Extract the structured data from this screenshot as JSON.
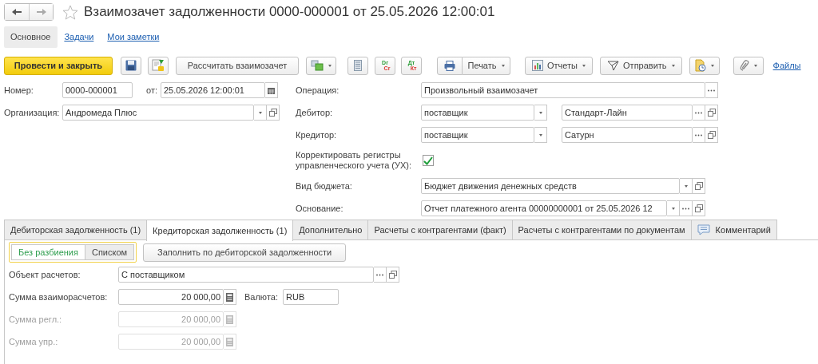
{
  "window": {
    "title": "Взаимозачет задолженности 0000-000001 от 25.05.2026 12:00:01"
  },
  "sections": [
    {
      "label": "Основное",
      "selected": true
    },
    {
      "label": "Задачи",
      "selected": false
    },
    {
      "label": "Мои заметки",
      "selected": false
    }
  ],
  "toolbar": {
    "post": "Провести и закрыть",
    "calculate": "Рассчитать взаимозачет",
    "dr_cr": [
      "Dr",
      "Cr"
    ],
    "dt_kt": [
      "Дт",
      "Кт"
    ],
    "print": "Печать",
    "reports": "Отчеты",
    "send": "Отправить",
    "files": "Файлы"
  },
  "header": {
    "number_label": "Номер:",
    "number": "0000-000001",
    "date_label": "от:",
    "date": "25.05.2026 12:00:01",
    "organization_label": "Организация:",
    "organization": "Андромеда Плюс"
  },
  "details": [
    {
      "kind": "choice",
      "label": "Операция:",
      "value": "Произвольный взаимозачет"
    },
    {
      "kind": "party",
      "label": "Дебитор:",
      "role": "поставщик",
      "value": "Стандарт-Лайн"
    },
    {
      "kind": "party",
      "label": "Кредитор:",
      "role": "поставщик",
      "value": "Сатурн"
    },
    {
      "kind": "checkbox",
      "label": "Корректировать регистры управленческого учета (УХ):",
      "checked": true
    },
    {
      "kind": "select",
      "label": "Вид бюджета:",
      "value": "Бюджет движения денежных средств"
    },
    {
      "kind": "reference",
      "label": "Основание:",
      "value": "Отчет платежного агента 00000000001 от 25.05.2026 12"
    }
  ],
  "tabs": [
    {
      "label": "Дебиторская задолженность (1)",
      "selected": false,
      "kind": "plain"
    },
    {
      "label": "Кредиторская задолженность (1)",
      "selected": true,
      "kind": "plain"
    },
    {
      "label": "Дополнительно",
      "selected": false,
      "kind": "plain"
    },
    {
      "label": "Расчеты с контрагентами (факт)",
      "selected": false,
      "kind": "plain"
    },
    {
      "label": "Расчеты с контрагентами по документам",
      "selected": false,
      "kind": "plain"
    },
    {
      "label": "Комментарий",
      "selected": false,
      "kind": "comment"
    }
  ],
  "split_mode": [
    {
      "label": "Без разбиения",
      "selected": true
    },
    {
      "label": "Списком",
      "selected": false
    }
  ],
  "fill_button": "Заполнить по дебиторской задолженности",
  "settlement": {
    "object_label": "Объект расчетов:",
    "object": "С поставщиком",
    "currency_label": "Валюта:",
    "currency": "RUB",
    "amounts": [
      {
        "label": "Сумма взаиморасчетов:",
        "value": "20 000,00",
        "disabled": false
      },
      {
        "label": "Сумма регл.:",
        "value": "20 000,00",
        "disabled": true
      },
      {
        "label": "Сумма упр.:",
        "value": "20 000,00",
        "disabled": true
      }
    ]
  }
}
